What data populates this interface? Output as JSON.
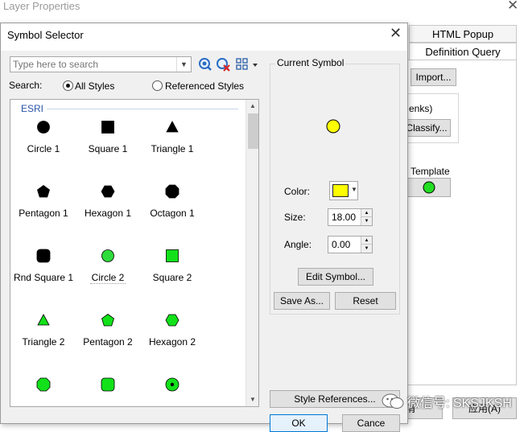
{
  "background_window": {
    "title": "Layer Properties",
    "tabs": [
      "HTML Popup",
      "Definition Query"
    ],
    "import_label": "Import...",
    "partial_text": "enks)",
    "classify_label": "Classify...",
    "template_label": "Template",
    "bottom_left_label": "消",
    "apply_label": "应用(A)"
  },
  "dialog": {
    "title": "Symbol Selector",
    "close_glyph": "✕"
  },
  "search": {
    "placeholder": "Type here to search",
    "label": "Search:",
    "all_styles_label": "All Styles",
    "referenced_styles_label": "Referenced Styles",
    "selected": "All Styles"
  },
  "symbol_list": {
    "group_label": "ESRI",
    "selected_symbol": "Circle 2",
    "items": [
      {
        "label": "Circle 1",
        "shape": "circle",
        "color": "#000000"
      },
      {
        "label": "Square 1",
        "shape": "square",
        "color": "#000000"
      },
      {
        "label": "Triangle 1",
        "shape": "triangle",
        "color": "#000000"
      },
      {
        "label": "Pentagon 1",
        "shape": "pentagon",
        "color": "#000000"
      },
      {
        "label": "Hexagon 1",
        "shape": "hexagon",
        "color": "#000000"
      },
      {
        "label": "Octagon 1",
        "shape": "octagon",
        "color": "#000000"
      },
      {
        "label": "Rnd Square 1",
        "shape": "roundsquare",
        "color": "#000000"
      },
      {
        "label": "Circle 2",
        "shape": "circle",
        "color": "#2edb3a"
      },
      {
        "label": "Square 2",
        "shape": "square",
        "color": "#12e11a"
      },
      {
        "label": "Triangle 2",
        "shape": "triangle",
        "color": "#12e11a"
      },
      {
        "label": "Pentagon 2",
        "shape": "pentagon",
        "color": "#12e11a"
      },
      {
        "label": "Hexagon 2",
        "shape": "hexagon",
        "color": "#12e11a"
      },
      {
        "label": "",
        "shape": "octagon",
        "color": "#12e11a"
      },
      {
        "label": "",
        "shape": "roundsquare",
        "color": "#12e11a"
      },
      {
        "label": "",
        "shape": "dotcircle",
        "color": "#12e11a"
      }
    ]
  },
  "current_symbol": {
    "title": "Current Symbol",
    "preview_color": "#ffff00",
    "color_label": "Color:",
    "color_value": "#ffff00",
    "size_label": "Size:",
    "size_value": "18.00",
    "angle_label": "Angle:",
    "angle_value": "0.00",
    "edit_symbol_label": "Edit Symbol...",
    "save_as_label": "Save As...",
    "reset_label": "Reset"
  },
  "footer": {
    "style_references_label": "Style References...",
    "ok_label": "OK",
    "cancel_label": "Cance"
  },
  "watermark": {
    "text": "微信号: SKSJKSH"
  }
}
